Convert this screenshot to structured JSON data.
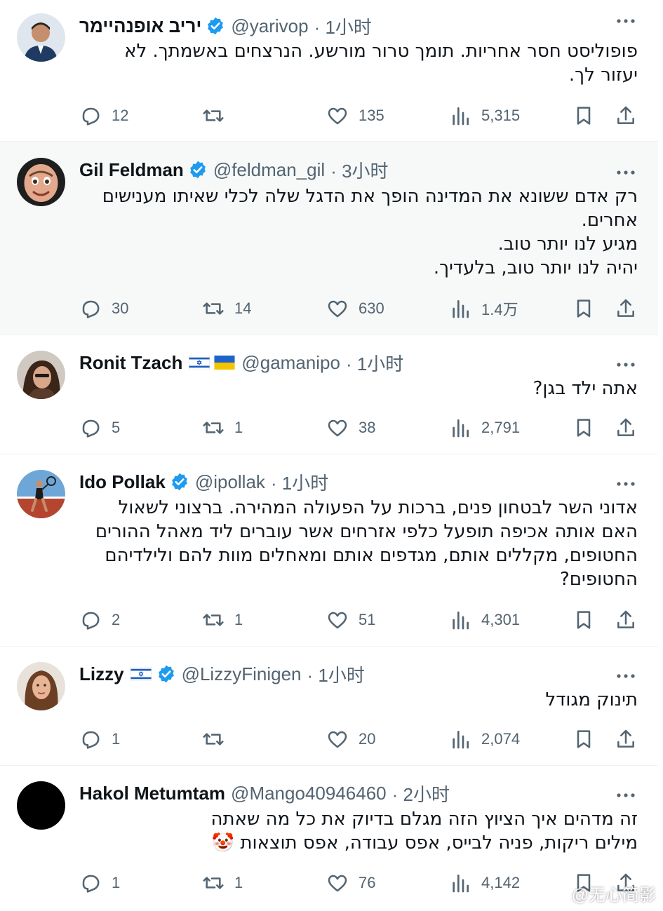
{
  "colors": {
    "text": "#0f1419",
    "secondary": "#536471",
    "verified": "#1d9bf0",
    "separator": "#eff3f4",
    "alt_background": "#f7f9f9"
  },
  "icons": {
    "reply": "reply-icon",
    "retweet": "retweet-icon",
    "like": "heart-icon",
    "views": "views-icon",
    "bookmark": "bookmark-icon",
    "share": "share-icon",
    "more": "more-icon",
    "verified": "verified-badge-icon"
  },
  "tweets": [
    {
      "name": "יריב אופנהיימר",
      "verified": true,
      "handle": "@yarivop",
      "time": "· 1小时",
      "text": "פופוליסט חסר אחריות. תומך טרור מורשע. הנרצחים באשמתך. לא\nיעזור לך.",
      "replies": "12",
      "retweets": "",
      "likes": "135",
      "views": "5,315"
    },
    {
      "name": "Gil Feldman",
      "verified": true,
      "handle": "@feldman_gil",
      "time": "· 3小时",
      "text": "רק אדם ששונא את המדינה הופך את הדגל שלה לכלי שאיתו מענישים\nאחרים.\nמגיע לנו יותר טוב.\nיהיה לנו יותר טוב, בלעדיך.",
      "replies": "30",
      "retweets": "14",
      "likes": "630",
      "views": "1.4万"
    },
    {
      "name": "Ronit Tzach",
      "verified": false,
      "handle": "@gamanipo",
      "time": "· 1小时",
      "text": "אתה ילד בגן?",
      "replies": "5",
      "retweets": "1",
      "likes": "38",
      "views": "2,791"
    },
    {
      "name": "Ido Pollak",
      "verified": true,
      "handle": "@ipollak",
      "time": "· 1小时",
      "text": "אדוני השר לבטחון פנים, ברכות על הפעולה המהירה. ברצוני לשאול\nהאם אותה אכיפה תופעל כלפי אזרחים אשר עוברים ליד מאהל ההורים\nהחטופים, מקללים אותם, מגדפים אותם ומאחלים מוות להם ולילדיהם\nהחטופים?",
      "replies": "2",
      "retweets": "1",
      "likes": "51",
      "views": "4,301"
    },
    {
      "name": "Lizzy",
      "verified": true,
      "handle": "@LizzyFinigen",
      "time": "· 1小时",
      "text": "תינוק מגודל",
      "replies": "1",
      "retweets": "",
      "likes": "20",
      "views": "2,074"
    },
    {
      "name": "Hakol Metumtam",
      "verified": false,
      "handle": "@Mango40946460",
      "time": "· 2小时",
      "text": "זה מדהים איך הציוץ הזה מגלם בדיוק את כל מה שאתה\nמילים ריקות, פניה לבייס, אפס עבודה, אפס תוצאות 🤡",
      "replies": "1",
      "retweets": "1",
      "likes": "76",
      "views": "4,142"
    }
  ],
  "watermark": "@无心简影"
}
